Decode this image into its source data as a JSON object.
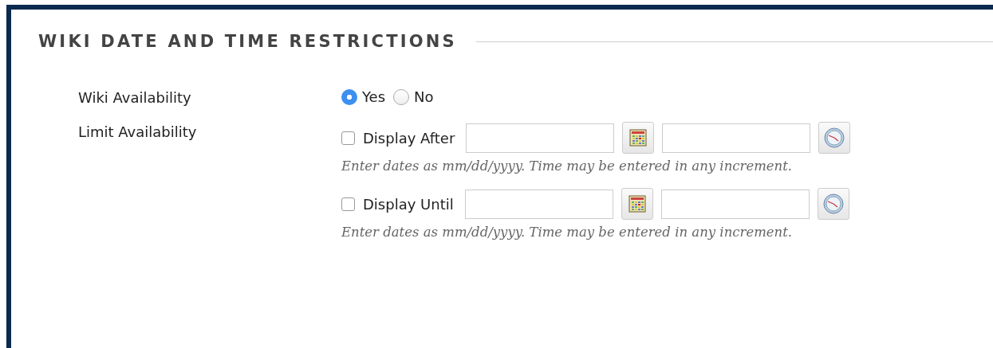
{
  "section": {
    "title": "WIKI DATE AND TIME RESTRICTIONS"
  },
  "availability": {
    "label": "Wiki Availability",
    "options": [
      {
        "label": "Yes",
        "selected": true
      },
      {
        "label": "No",
        "selected": false
      }
    ]
  },
  "limit": {
    "label": "Limit Availability",
    "rows": [
      {
        "label": "Display After",
        "checked": false,
        "hint": "Enter dates as mm/dd/yyyy. Time may be entered in any increment."
      },
      {
        "label": "Display Until",
        "checked": false,
        "hint": "Enter dates as mm/dd/yyyy. Time may be entered in any increment."
      }
    ]
  }
}
